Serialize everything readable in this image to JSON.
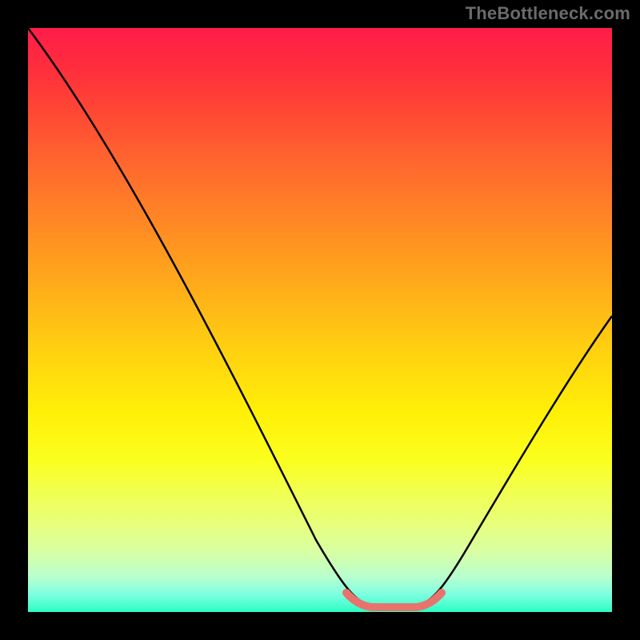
{
  "watermark": "TheBottleneck.com",
  "chart_data": {
    "type": "line",
    "title": "",
    "xlabel": "",
    "ylabel": "",
    "xlim": [
      0,
      100
    ],
    "ylim": [
      0,
      100
    ],
    "grid": false,
    "legend": false,
    "annotations": [],
    "series": [
      {
        "name": "main-curve",
        "color": "#000000",
        "x": [
          5,
          10,
          15,
          20,
          25,
          30,
          35,
          40,
          45,
          50,
          55,
          58,
          60,
          62,
          64,
          66,
          68,
          70,
          75,
          80,
          85,
          90,
          95,
          100
        ],
        "y": [
          100,
          93,
          86,
          78,
          70,
          62,
          54,
          45,
          36,
          26,
          14,
          7,
          3,
          1,
          1,
          1,
          3,
          7,
          15,
          23,
          31,
          39,
          46,
          53
        ]
      },
      {
        "name": "bottom-marker",
        "color": "#e8736d",
        "x": [
          58,
          70
        ],
        "y": [
          3,
          3
        ]
      }
    ],
    "gradient_stops": [
      {
        "pos": 0,
        "color": "#ff1d4a"
      },
      {
        "pos": 6,
        "color": "#ff2b3e"
      },
      {
        "pos": 14,
        "color": "#ff4635"
      },
      {
        "pos": 24,
        "color": "#ff6a2d"
      },
      {
        "pos": 34,
        "color": "#ff8a24"
      },
      {
        "pos": 44,
        "color": "#ffab1a"
      },
      {
        "pos": 55,
        "color": "#ffd010"
      },
      {
        "pos": 66,
        "color": "#fff007"
      },
      {
        "pos": 74,
        "color": "#fbff1e"
      },
      {
        "pos": 80,
        "color": "#f0ff55"
      },
      {
        "pos": 85,
        "color": "#e7ff7c"
      },
      {
        "pos": 90,
        "color": "#d7ffa6"
      },
      {
        "pos": 94,
        "color": "#b8ffcf"
      },
      {
        "pos": 97,
        "color": "#7dffe0"
      },
      {
        "pos": 100,
        "color": "#2bffc4"
      }
    ]
  }
}
